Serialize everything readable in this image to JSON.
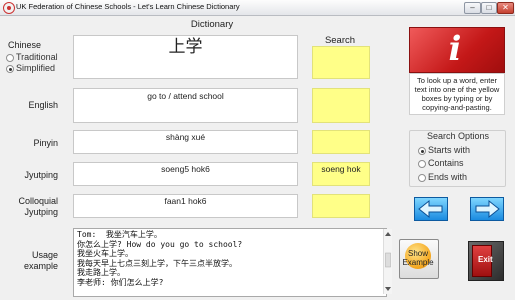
{
  "window": {
    "title": "UK Federation of Chinese Schools - Let's Learn Chinese Dictionary",
    "minimize": "–",
    "maximize": "□",
    "close": "✕"
  },
  "headers": {
    "dictionary": "Dictionary",
    "search": "Search"
  },
  "chinese": {
    "label": "Chinese",
    "options": [
      "Traditional",
      "Simplified"
    ],
    "selected": "Simplified",
    "value": "上学",
    "search": ""
  },
  "english": {
    "label": "English",
    "value": "go to / attend school",
    "search": ""
  },
  "pinyin": {
    "label": "Pinyin",
    "value": "shàng xué",
    "search": ""
  },
  "jyutping": {
    "label": "Jyutping",
    "value": "soeng5 hok6",
    "search": "soeng hok"
  },
  "colloquial": {
    "label_line1": "Colloquial",
    "label_line2": "Jyutping",
    "value": "faan1 hok6",
    "search": ""
  },
  "usage": {
    "label_line1": "Usage",
    "label_line2": "example",
    "text": "Tom:  我坐汽车上学。\n你怎么上学? How do you go to school?\n我坐火车上学。\n我每天早上七点三刻上学，下午三点半放学。\n我走路上学。\n李老师: 你们怎么上学?"
  },
  "help": {
    "button": "?",
    "info_icon": "i",
    "text": "To look up a word, enter text into one of the yellow boxes by typing or by copying-and-pasting."
  },
  "search_options": {
    "title": "Search Options",
    "options": [
      "Starts with",
      "Contains",
      "Ends with"
    ],
    "selected": "Starts with"
  },
  "buttons": {
    "show_example_line1": "Show",
    "show_example_line2": "Example",
    "exit": "Exit"
  },
  "colors": {
    "search_bg": "#ffff88",
    "info_red": "#c41818",
    "nav_blue": "#1b8be0"
  },
  "icons": {
    "info": "info-icon",
    "prev": "arrow-left-icon",
    "next": "arrow-right-icon",
    "exit": "exit-door-icon",
    "show": "show-example-icon"
  }
}
